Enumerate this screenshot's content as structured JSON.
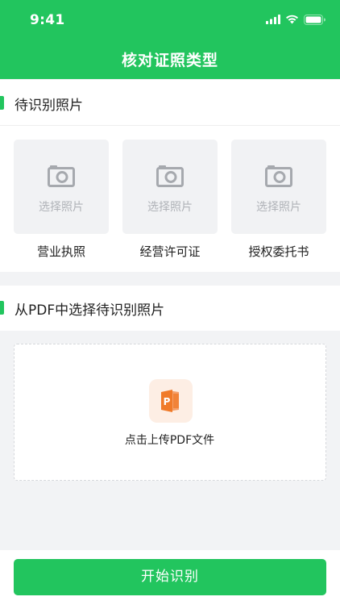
{
  "status_bar": {
    "time": "9:41"
  },
  "header": {
    "title": "核对证照类型"
  },
  "section1": {
    "title": "待识别照片",
    "cards": [
      {
        "hint": "选择照片",
        "label": "营业执照"
      },
      {
        "hint": "选择照片",
        "label": "经营许可证"
      },
      {
        "hint": "选择照片",
        "label": "授权委托书"
      }
    ]
  },
  "section2": {
    "title": "从PDF中选择待识别照片",
    "upload_text": "点击上传PDF文件",
    "pdf_icon_letter": "P"
  },
  "bottom": {
    "start_label": "开始识别"
  },
  "colors": {
    "brand": "#22c55e",
    "pdf_orange": "#f07a28",
    "card_bg": "#f1f2f4"
  }
}
